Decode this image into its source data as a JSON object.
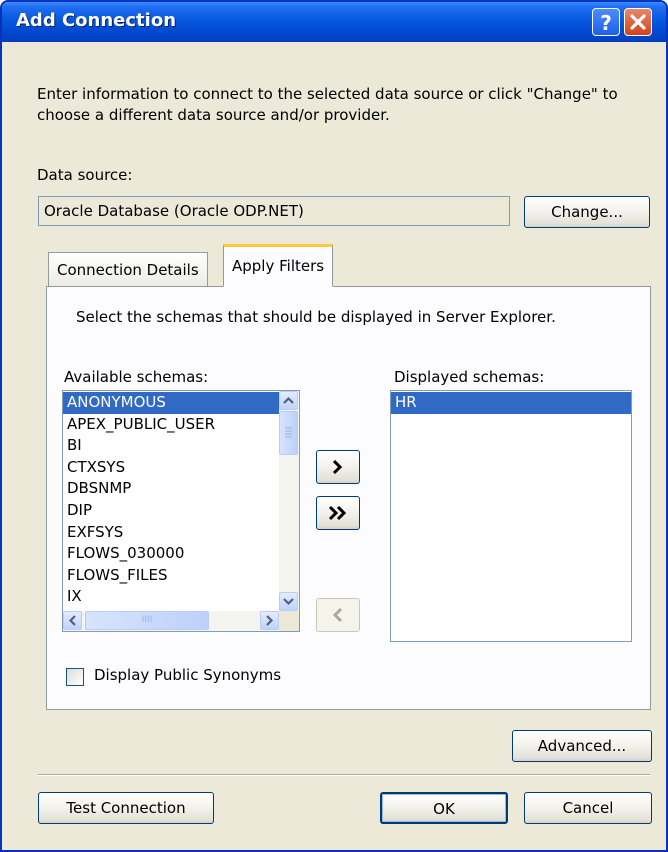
{
  "window": {
    "title": "Add Connection"
  },
  "intro_text": "Enter information to connect to the selected data source or click \"Change\" to choose a different data source and/or provider.",
  "data_source": {
    "label": "Data source:",
    "value": "Oracle Database (Oracle ODP.NET)",
    "change_label": "Change..."
  },
  "tabs": [
    {
      "label": "Connection Details",
      "active": false
    },
    {
      "label": "Apply Filters",
      "active": true
    }
  ],
  "filters": {
    "instruction": "Select the schemas that should be displayed in Server Explorer.",
    "available_label": "Available schemas:",
    "available": [
      "ANONYMOUS",
      "APEX_PUBLIC_USER",
      "BI",
      "CTXSYS",
      "DBSNMP",
      "DIP",
      "EXFSYS",
      "FLOWS_030000",
      "FLOWS_FILES",
      "IX"
    ],
    "available_selected": "ANONYMOUS",
    "displayed_label": "Displayed schemas:",
    "displayed": [
      "HR"
    ],
    "displayed_selected": "HR",
    "hscroll_thumb_glyph": "IIII",
    "synonyms_label": "Display Public Synonyms",
    "synonyms_checked": false
  },
  "buttons": {
    "advanced": "Advanced...",
    "test_connection": "Test Connection",
    "ok": "OK",
    "cancel": "Cancel"
  },
  "icons": {
    "help": "help-icon",
    "close": "close-icon",
    "move_right": "chevron-right-icon",
    "move_all_right": "double-chevron-right-icon",
    "move_left": "chevron-left-icon"
  },
  "colors": {
    "titlebar": "#0858e0",
    "selection": "#316ac5",
    "dialog_bg": "#ece9d8",
    "active_tab_accent": "#ffc83c",
    "close_button": "#d0431a"
  }
}
